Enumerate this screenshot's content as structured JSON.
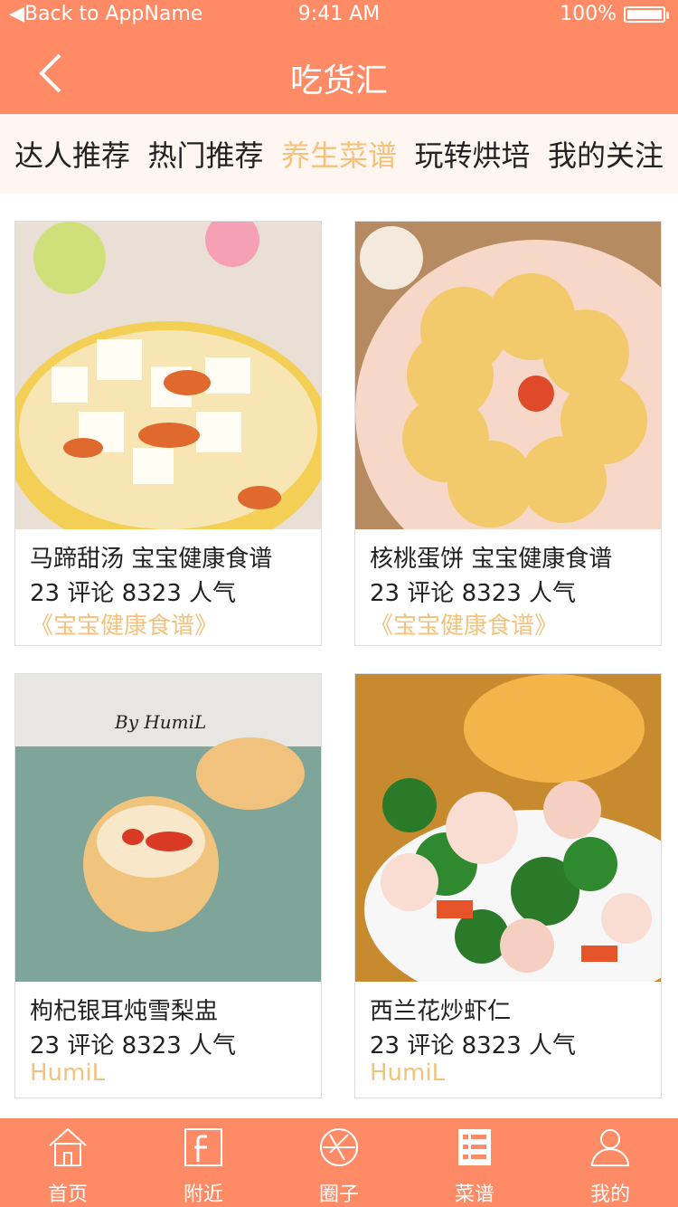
{
  "status": {
    "left": "Back to AppName",
    "time": "9:41 AM",
    "battery": "100%"
  },
  "nav": {
    "title": "吃货汇"
  },
  "tabs": [
    "达人推荐",
    "热门推荐",
    "养生菜谱",
    "玩转烘培",
    "我的关注"
  ],
  "active_tab": 2,
  "cards": [
    {
      "title": "马蹄甜汤 宝宝健康食谱",
      "stats": "23 评论  8323 人气",
      "tag": "《宝宝健康食谱》"
    },
    {
      "title": "核桃蛋饼 宝宝健康食谱",
      "stats": "23 评论  8323 人气",
      "tag": "《宝宝健康食谱》"
    },
    {
      "title": "枸杞银耳炖雪梨盅",
      "stats": "23 评论  8323 人气",
      "tag": "HumiL",
      "img_text": "By HumiL"
    },
    {
      "title": "西兰花炒虾仁",
      "stats": "23 评论  8323 人气",
      "tag": "HumiL"
    }
  ],
  "tabbar": [
    {
      "label": "首页",
      "icon": "home-icon"
    },
    {
      "label": "附近",
      "icon": "nearby-icon"
    },
    {
      "label": "圈子",
      "icon": "circle-icon"
    },
    {
      "label": "菜谱",
      "icon": "recipe-icon"
    },
    {
      "label": "我的",
      "icon": "profile-icon"
    }
  ],
  "colors": {
    "primary": "#ff8a66",
    "accent": "#f3c27c",
    "tab_bg": "#fff5f1"
  }
}
